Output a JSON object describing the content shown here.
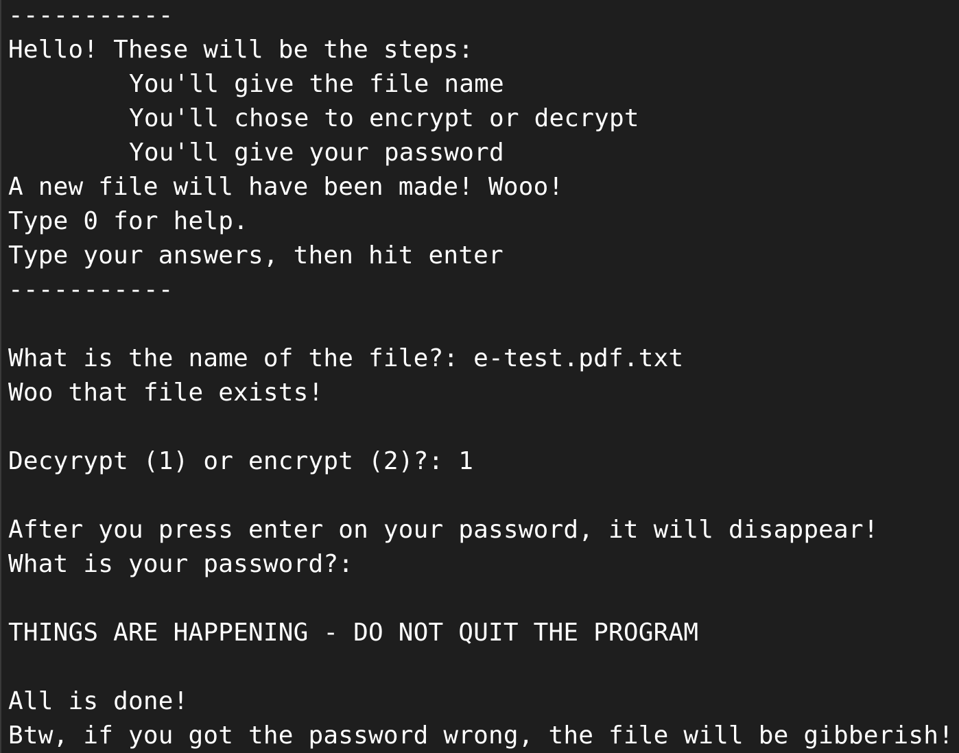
{
  "terminal": {
    "lines": [
      "-----------",
      "Hello! These will be the steps:",
      "You'll give the file name",
      "You'll chose to encrypt or decrypt",
      "You'll give your password",
      "A new file will have been made! Wooo!",
      "Type 0 for help.",
      "Type your answers, then hit enter",
      "-----------",
      "",
      "What is the name of the file?: e-test.pdf.txt",
      "Woo that file exists!",
      "",
      "Decyrypt (1) or encrypt (2)?: 1",
      "",
      "After you press enter on your password, it will disappear!",
      "What is your password?:",
      "",
      "THINGS ARE HAPPENING - DO NOT QUIT THE PROGRAM",
      "",
      "All is done!",
      "Btw, if you got the password wrong, the file will be gibberish!"
    ]
  }
}
